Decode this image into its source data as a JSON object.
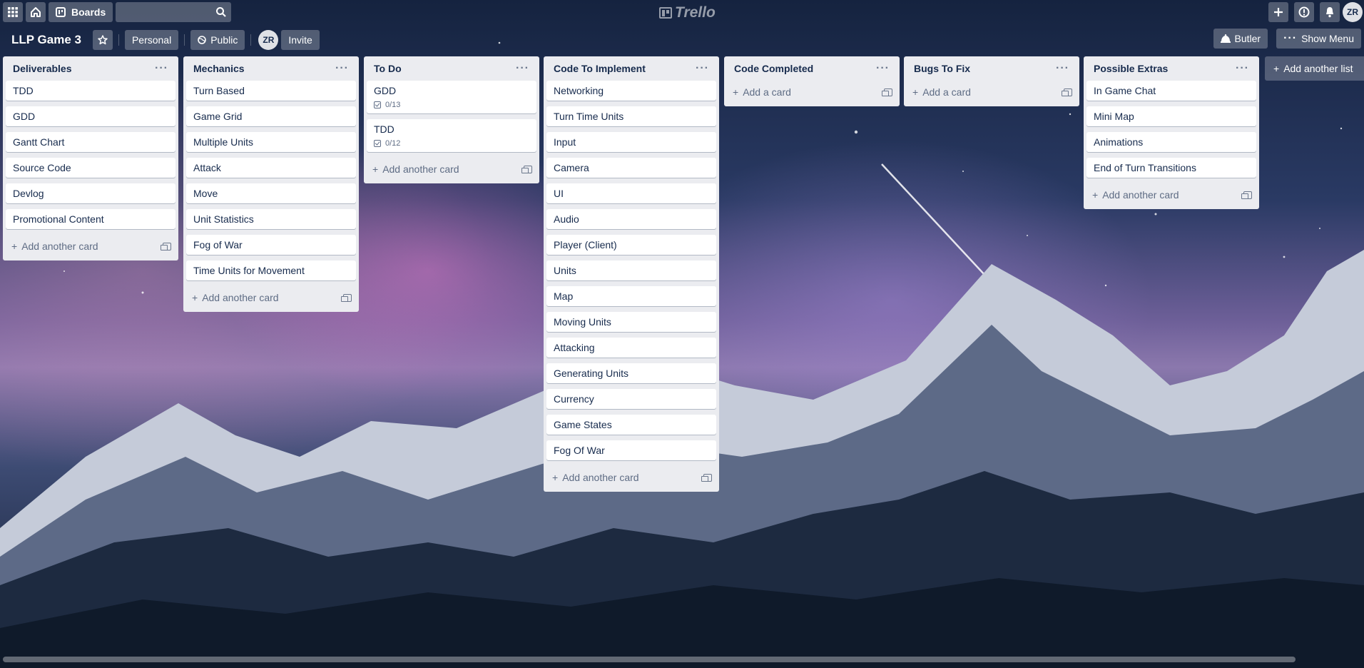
{
  "topbar": {
    "boards_label": "Boards",
    "search_value": "",
    "logo_text": "Trello",
    "avatar_initials": "ZR"
  },
  "board": {
    "title": "LLP Game 3",
    "team_label": "Personal",
    "visibility_label": "Public",
    "member_initials": "ZR",
    "invite_label": "Invite",
    "butler_label": "Butler",
    "show_menu_label": "Show Menu"
  },
  "lists": [
    {
      "title": "Deliverables",
      "cards": [
        {
          "title": "TDD"
        },
        {
          "title": "GDD"
        },
        {
          "title": "Gantt Chart"
        },
        {
          "title": "Source Code"
        },
        {
          "title": "Devlog"
        },
        {
          "title": "Promotional Content"
        }
      ],
      "add_label": "Add another card"
    },
    {
      "title": "Mechanics",
      "cards": [
        {
          "title": "Turn Based"
        },
        {
          "title": "Game Grid"
        },
        {
          "title": "Multiple Units"
        },
        {
          "title": "Attack"
        },
        {
          "title": "Move"
        },
        {
          "title": "Unit Statistics"
        },
        {
          "title": "Fog of War"
        },
        {
          "title": "Time Units for Movement"
        }
      ],
      "add_label": "Add another card"
    },
    {
      "title": "To Do",
      "cards": [
        {
          "title": "GDD",
          "checklist": "0/13"
        },
        {
          "title": "TDD",
          "checklist": "0/12"
        }
      ],
      "add_label": "Add another card"
    },
    {
      "title": "Code To Implement",
      "cards": [
        {
          "title": "Networking"
        },
        {
          "title": "Turn Time Units"
        },
        {
          "title": "Input"
        },
        {
          "title": "Camera"
        },
        {
          "title": "UI"
        },
        {
          "title": "Audio"
        },
        {
          "title": "Player (Client)"
        },
        {
          "title": "Units"
        },
        {
          "title": "Map"
        },
        {
          "title": "Moving Units"
        },
        {
          "title": "Attacking"
        },
        {
          "title": "Generating Units"
        },
        {
          "title": "Currency"
        },
        {
          "title": "Game States"
        },
        {
          "title": "Fog Of War"
        }
      ],
      "add_label": "Add another card"
    },
    {
      "title": "Code Completed",
      "cards": [],
      "add_label": "Add a card"
    },
    {
      "title": "Bugs To Fix",
      "cards": [],
      "add_label": "Add a card"
    },
    {
      "title": "Possible Extras",
      "cards": [
        {
          "title": "In Game Chat"
        },
        {
          "title": "Mini Map"
        },
        {
          "title": "Animations"
        },
        {
          "title": "End of Turn Transitions"
        }
      ],
      "add_label": "Add another card"
    }
  ],
  "add_list_label": "Add another list",
  "icons": [
    "apps-icon",
    "home-icon",
    "boards-icon",
    "search-icon",
    "trello-logo-icon",
    "plus-icon",
    "info-icon",
    "bell-icon",
    "star-icon",
    "globe-icon",
    "butler-icon",
    "dots-icon",
    "checklist-icon",
    "template-icon"
  ]
}
